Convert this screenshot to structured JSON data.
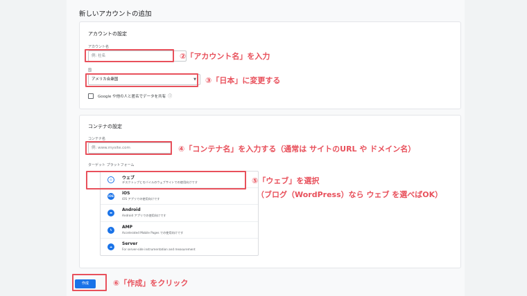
{
  "page": {
    "title": "新しいアカウントの追加"
  },
  "account_settings": {
    "title": "アカウントの設定",
    "name_label": "アカウント名",
    "name_placeholder": "例: 社名",
    "country_label": "国",
    "country_value": "アメリカ合衆国",
    "data_sharing_text": "Google や他の人と匿名でデータを共有",
    "help_icon": "help-circle-icon"
  },
  "container_settings": {
    "title": "コンテナの設定",
    "name_label": "コンテナ名",
    "name_placeholder": "例: www.mysite.com",
    "platform_label": "ターゲット プラットフォーム",
    "platforms": [
      {
        "name": "ウェブ",
        "desc": "デスクトップとモバイルのウェブサイトでの使用向けです",
        "icon": "globe-icon"
      },
      {
        "name": "iOS",
        "desc": "iOS アプリでの使用向けです",
        "icon": "ios-icon"
      },
      {
        "name": "Android",
        "desc": "Android アプリでの使用向けです",
        "icon": "android-icon"
      },
      {
        "name": "AMP",
        "desc": "Accelerated Mobile Pages での使用向けです",
        "icon": "amp-bolt-icon"
      },
      {
        "name": "Server",
        "desc": "For server-side instrumentation and measurement",
        "icon": "cloud-icon"
      }
    ]
  },
  "create_button": {
    "label": "作成"
  },
  "annotations": {
    "a2": "②「アカウント名」を入力",
    "a3": "③「日本」に変更する",
    "a4": "④「コンテナ名」を入力する（通常は サイトのURL や ドメイン名）",
    "a5_line1": "⑤「ウェブ」を選択",
    "a5_line2": "（ブログ（WordPress）なら ウェブ を選べばOK）",
    "a6": "⑥「作成」をクリック"
  },
  "colors": {
    "accent": "#1a73e8",
    "annotation": "#e8505b"
  }
}
